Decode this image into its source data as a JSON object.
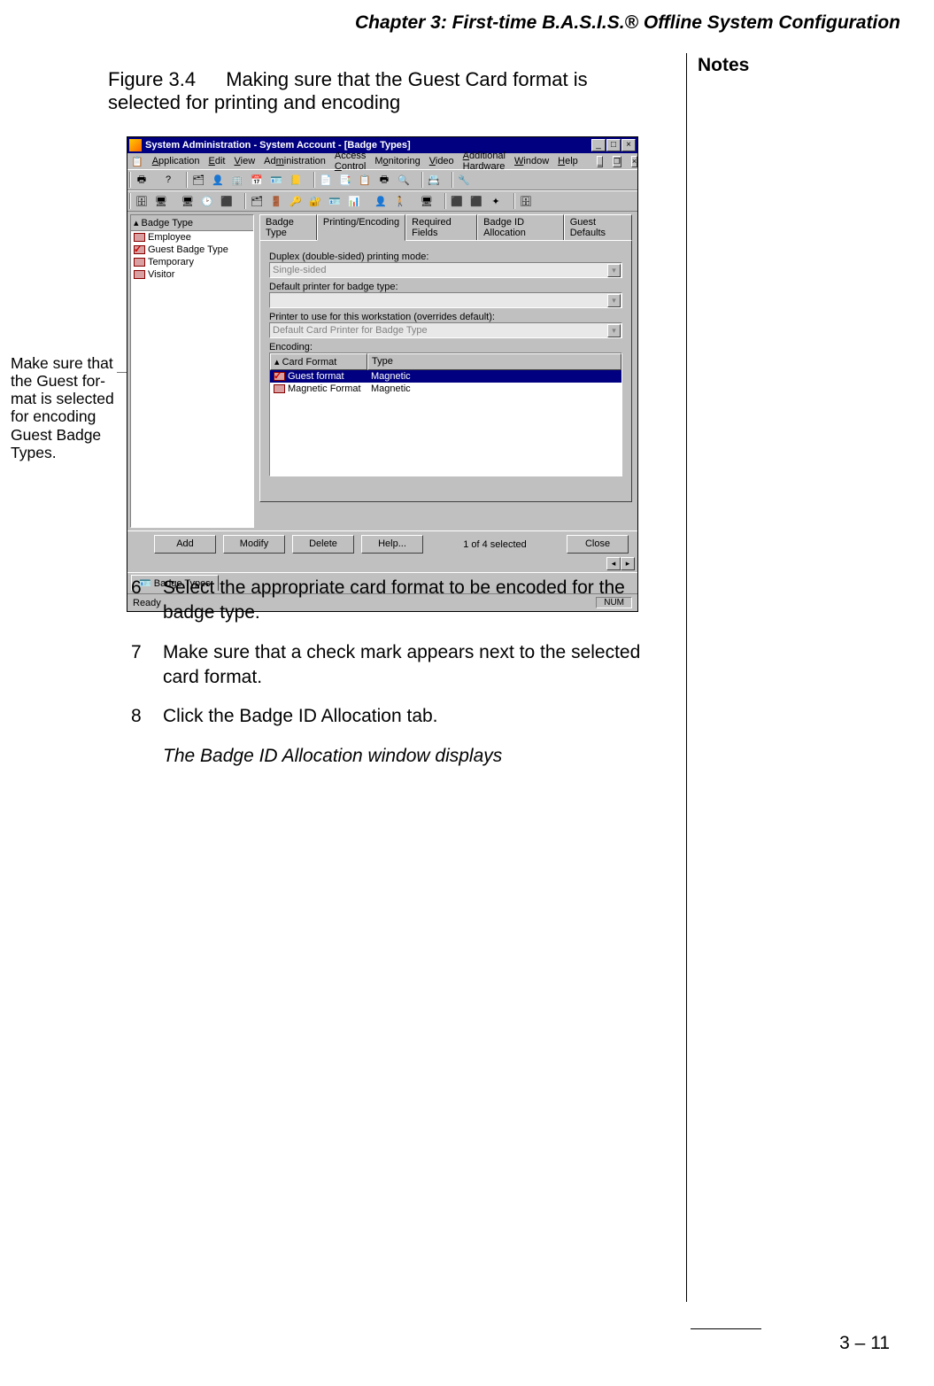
{
  "header": {
    "chapter": "Chapter 3: First-time B.A.S.I.S.® Offline System Configuration"
  },
  "notes_label": "Notes",
  "figure": {
    "num": "Figure 3.4",
    "title": "Making sure that the Guest Card format is selected for printing and encoding"
  },
  "callout": "Make sure that the Guest for-mat is selected for encoding Guest Badge Types.",
  "window": {
    "title": "System Administration - System Account - [Badge Types]",
    "menu": [
      "Application",
      "Edit",
      "View",
      "Administration",
      "Access Control",
      "Monitoring",
      "Video",
      "Additional Hardware",
      "Window",
      "Help"
    ],
    "left_header": "Badge Type",
    "left_items": [
      "Employee",
      "Guest Badge Type",
      "Temporary",
      "Visitor"
    ],
    "tabs": [
      "Badge Type",
      "Printing/Encoding",
      "Required Fields",
      "Badge ID Allocation",
      "Guest Defaults"
    ],
    "field_labels": {
      "duplex": "Duplex (double-sided) printing mode:",
      "duplex_val": "Single-sided",
      "printer": "Default printer for badge type:",
      "printer_override": "Printer to use for this workstation (overrides default):",
      "printer_override_val": "Default Card Printer for Badge Type",
      "encoding": "Encoding:"
    },
    "enc_headers": [
      "Card Format",
      "Type"
    ],
    "enc_rows": [
      {
        "name": "Guest format",
        "type": "Magnetic",
        "sel": true,
        "check": true
      },
      {
        "name": "Magnetic Format",
        "type": "Magnetic",
        "sel": false,
        "check": false
      }
    ],
    "buttons": {
      "add": "Add",
      "modify": "Modify",
      "delete": "Delete",
      "help": "Help...",
      "close": "Close"
    },
    "sel_status": "1 of 4 selected",
    "task_tab": "Badge Types",
    "status_ready": "Ready",
    "status_num": "NUM"
  },
  "steps": [
    {
      "n": "6",
      "t": "Select the appropriate card format to be encoded for the badge type."
    },
    {
      "n": "7",
      "t": "Make sure that a check mark appears next to the selected card format."
    },
    {
      "n": "8",
      "t": "Click the Badge ID Allocation tab."
    }
  ],
  "step_note": "The Badge ID Allocation window displays",
  "page_number": "3 – 11"
}
